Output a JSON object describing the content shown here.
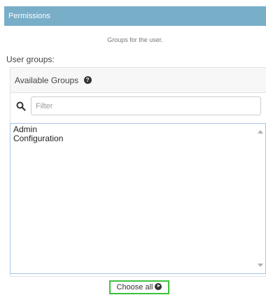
{
  "section": {
    "title": "Permissions"
  },
  "field": {
    "help_text": "Groups for the user.",
    "label": "User groups:"
  },
  "selector": {
    "title": "Available Groups",
    "help_icon": "question-circle-icon",
    "search_icon": "search-icon",
    "filter_placeholder": "Filter",
    "filter_value": "",
    "options": [
      "Admin",
      "Configuration"
    ],
    "choose_all_label": "Choose all",
    "choose_all_icon": "arrow-circle-right-icon"
  },
  "colors": {
    "header_bg": "#79aec8",
    "list_border": "#a8c4e8",
    "highlight_border": "#3cc23c"
  }
}
